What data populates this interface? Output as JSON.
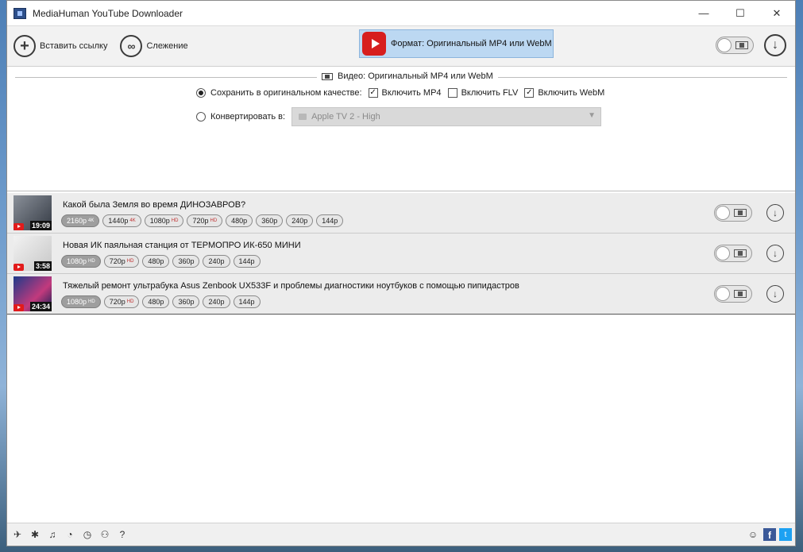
{
  "window": {
    "title": "MediaHuman YouTube Downloader"
  },
  "titlebar_controls": {
    "minimize": "—",
    "maximize": "☐",
    "close": "✕"
  },
  "toolbar": {
    "paste_link_label": "Вставить ссылку",
    "tracking_label": "Слежение",
    "format_label": "Формат: Оригинальный MP4 или WebM"
  },
  "settings": {
    "section_title": "Видео: Оригинальный MP4 или WebM",
    "keep_original_label": "Сохранить в оригинальном качестве:",
    "keep_original_selected": true,
    "include_mp4_label": "Включить MP4",
    "include_mp4_checked": true,
    "include_flv_label": "Включить FLV",
    "include_flv_checked": false,
    "include_webm_label": "Включить WebM",
    "include_webm_checked": true,
    "convert_label": "Конвертировать в:",
    "convert_selected": false,
    "convert_preset": "Apple TV 2 - High"
  },
  "videos": [
    {
      "title": "Какой была Земля во время ДИНОЗАВРОВ?",
      "duration": "19:09",
      "qualities": [
        {
          "label": "2160p",
          "badge": "4K",
          "selected": true
        },
        {
          "label": "1440p",
          "badge": "4K",
          "selected": false
        },
        {
          "label": "1080p",
          "badge": "HD",
          "selected": false
        },
        {
          "label": "720p",
          "badge": "HD",
          "selected": false
        },
        {
          "label": "480p",
          "badge": "",
          "selected": false
        },
        {
          "label": "360p",
          "badge": "",
          "selected": false
        },
        {
          "label": "240p",
          "badge": "",
          "selected": false
        },
        {
          "label": "144p",
          "badge": "",
          "selected": false
        }
      ]
    },
    {
      "title": "Новая ИК паяльная станция от ТЕРМОПРО ИК-650 МИНИ",
      "duration": "3:58",
      "qualities": [
        {
          "label": "1080p",
          "badge": "HD",
          "selected": true
        },
        {
          "label": "720p",
          "badge": "HD",
          "selected": false
        },
        {
          "label": "480p",
          "badge": "",
          "selected": false
        },
        {
          "label": "360p",
          "badge": "",
          "selected": false
        },
        {
          "label": "240p",
          "badge": "",
          "selected": false
        },
        {
          "label": "144p",
          "badge": "",
          "selected": false
        }
      ]
    },
    {
      "title": "Тяжелый ремонт ультрабука Asus Zenbook UX533F и проблемы диагностики ноутбуков с помощью пипидастров",
      "duration": "24:34",
      "qualities": [
        {
          "label": "1080p",
          "badge": "HD",
          "selected": true
        },
        {
          "label": "720p",
          "badge": "HD",
          "selected": false
        },
        {
          "label": "480p",
          "badge": "",
          "selected": false
        },
        {
          "label": "360p",
          "badge": "",
          "selected": false
        },
        {
          "label": "240p",
          "badge": "",
          "selected": false
        },
        {
          "label": "144p",
          "badge": "",
          "selected": false
        }
      ]
    }
  ],
  "statusbar": {
    "icons": [
      "send-icon",
      "gear-icon",
      "music-note-icon",
      "snail-icon",
      "clock-icon",
      "binoculars-icon",
      "help-icon"
    ],
    "glyphs": [
      "✈",
      "✱",
      "♫",
      "◔",
      "◷",
      "⚇",
      "?"
    ],
    "social": [
      "support-icon",
      "facebook-icon",
      "twitter-icon"
    ],
    "facebook_glyph": "f",
    "twitter_glyph": "t"
  },
  "colors": {
    "format_button_bg": "#bcd8f2",
    "youtube_red": "#d71e1e",
    "accent_check": "#222222"
  }
}
